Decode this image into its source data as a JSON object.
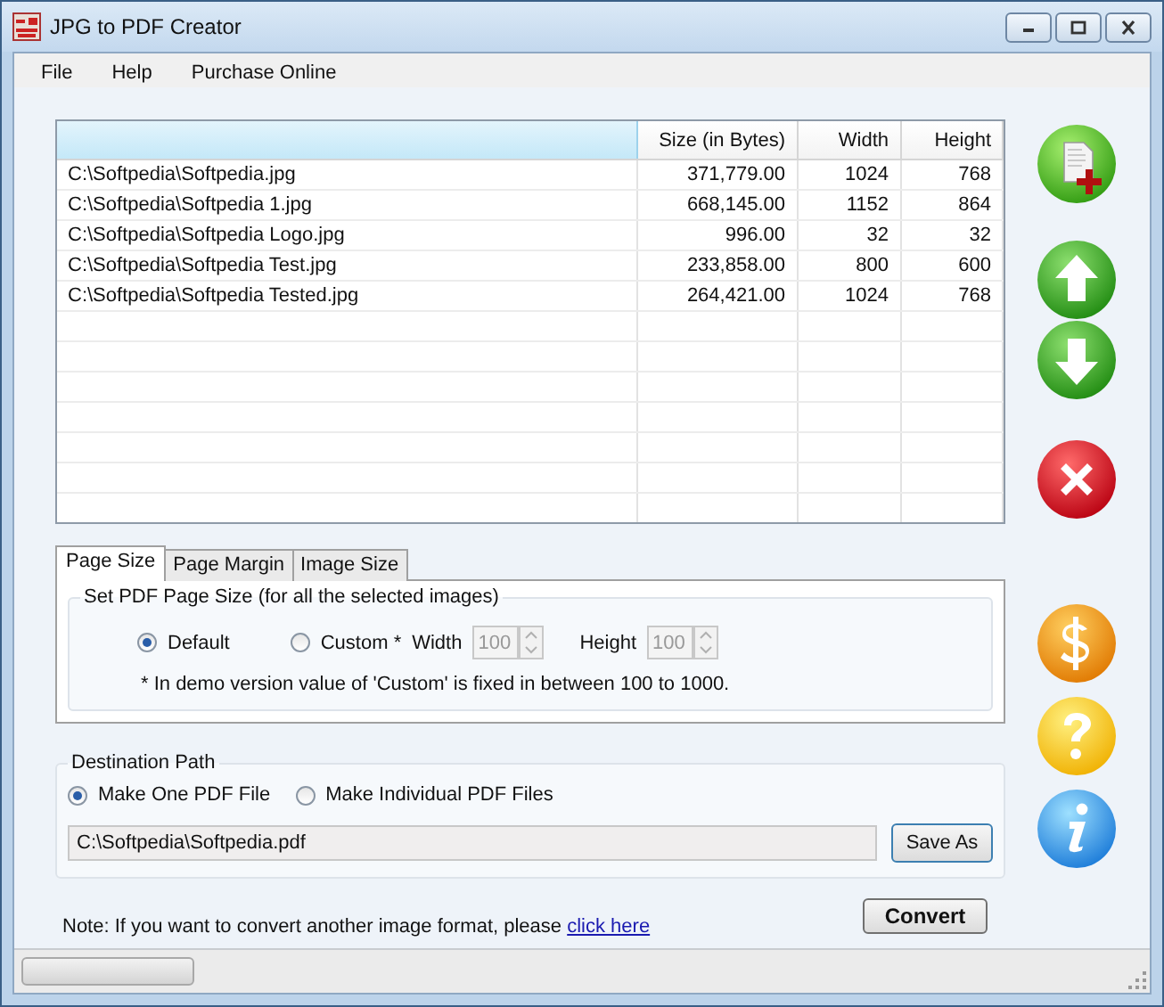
{
  "window": {
    "title": "JPG to PDF Creator"
  },
  "menu": [
    {
      "label": "File"
    },
    {
      "label": "Help"
    },
    {
      "label": "Purchase Online"
    }
  ],
  "table": {
    "columns": [
      "",
      "Size (in Bytes)",
      "Width",
      "Height"
    ],
    "rows": [
      {
        "cells": [
          "C:\\Softpedia\\Softpedia.jpg",
          "371,779.00",
          "1024",
          "768"
        ]
      },
      {
        "cells": [
          "C:\\Softpedia\\Softpedia 1.jpg",
          "668,145.00",
          "1152",
          "864"
        ]
      },
      {
        "cells": [
          "C:\\Softpedia\\Softpedia Logo.jpg",
          "996.00",
          "32",
          "32"
        ]
      },
      {
        "cells": [
          "C:\\Softpedia\\Softpedia Test.jpg",
          "233,858.00",
          "800",
          "600"
        ]
      },
      {
        "cells": [
          "C:\\Softpedia\\Softpedia Tested.jpg",
          "264,421.00",
          "1024",
          "768"
        ]
      }
    ]
  },
  "toolbar": [
    {
      "kind": "add"
    },
    {
      "kind": "up"
    },
    {
      "kind": "down"
    },
    {
      "kind": "delete"
    },
    {
      "kind": "purchase"
    },
    {
      "kind": "help"
    },
    {
      "kind": "about"
    }
  ],
  "tabs": [
    {
      "label": "Page Size",
      "selected": true
    },
    {
      "label": "Page Margin",
      "selected": false
    },
    {
      "label": "Image Size",
      "selected": false
    }
  ],
  "page_size": {
    "group_title": "Set PDF Page Size (for all the selected images)",
    "options": [
      {
        "label": "Default",
        "selected": true
      },
      {
        "label": "Custom *",
        "selected": false
      }
    ],
    "width_label": "Width",
    "width_value": "100",
    "height_label": "Height",
    "height_value": "100",
    "spinners_disabled": true,
    "note": "* In demo version value of 'Custom' is fixed in between 100 to 1000."
  },
  "destination": {
    "group_title": "Destination Path",
    "options": [
      {
        "label": "Make One PDF File",
        "selected": true
      },
      {
        "label": "Make Individual PDF Files",
        "selected": false
      }
    ],
    "path": "C:\\Softpedia\\Softpedia.pdf",
    "save_button": "Save As"
  },
  "note": {
    "text": "Note: If you want to convert another image format, please",
    "link": "click here"
  },
  "convert_button": "Convert"
}
